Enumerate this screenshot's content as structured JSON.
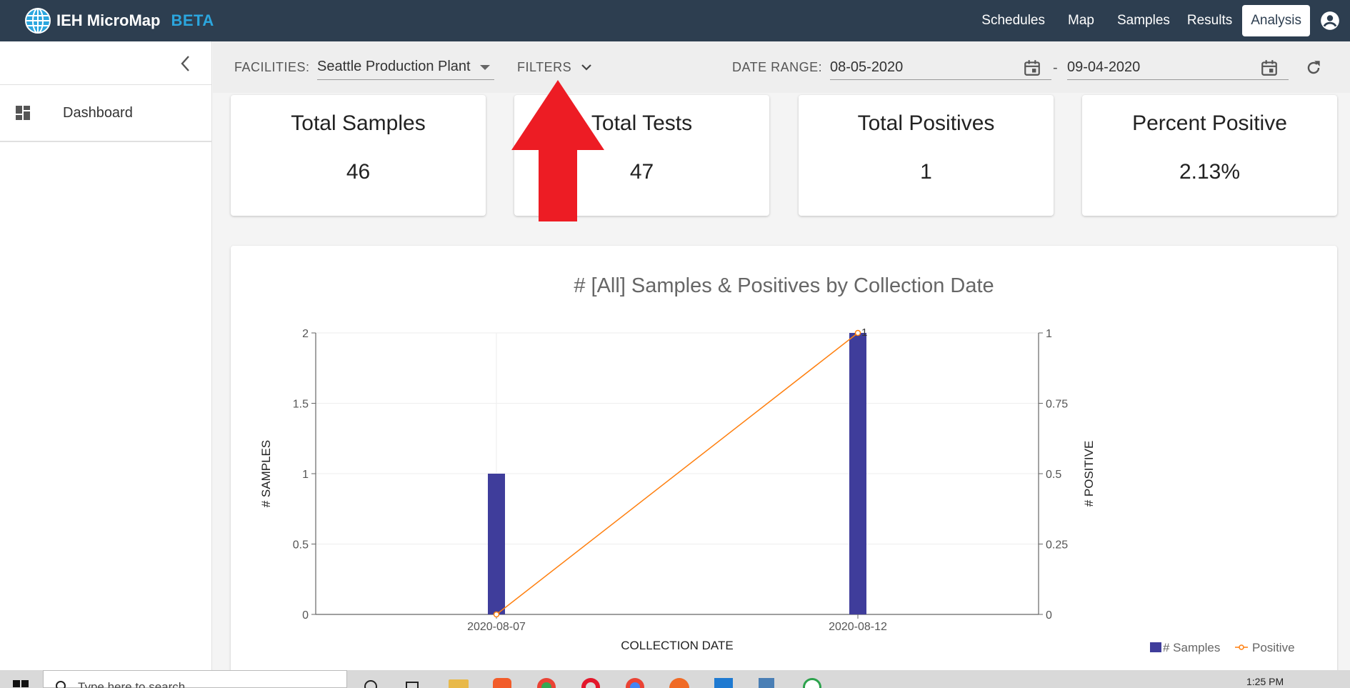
{
  "app": {
    "name": "IEH MicroMap",
    "badge": "BETA"
  },
  "nav": {
    "items": [
      {
        "label": "Schedules"
      },
      {
        "label": "Map"
      },
      {
        "label": "Samples"
      },
      {
        "label": "Results"
      },
      {
        "label": "Analysis"
      }
    ],
    "active": "Analysis"
  },
  "sidebar": {
    "items": [
      {
        "label": "Dashboard"
      }
    ]
  },
  "filters": {
    "facilities_label": "FACILITIES:",
    "facility_value": "Seattle Production Plant",
    "filters_label": "FILTERS",
    "date_range_label": "DATE RANGE:",
    "date_from": "08-05-2020",
    "date_sep": "-",
    "date_to": "09-04-2020"
  },
  "stats": [
    {
      "title": "Total Samples",
      "value": "46"
    },
    {
      "title": "Total Tests",
      "value": "47"
    },
    {
      "title": "Total Positives",
      "value": "1"
    },
    {
      "title": "Percent Positive",
      "value": "2.13%"
    }
  ],
  "chart_data": {
    "type": "bar",
    "title": "# [All] Samples & Positives by Collection Date",
    "xlabel": "COLLECTION DATE",
    "ylabel": "# SAMPLES",
    "y2label": "# POSITIVE",
    "categories": [
      "2020-08-07",
      "2020-08-12"
    ],
    "series": [
      {
        "name": "# Samples",
        "type": "bar",
        "axis": "left",
        "values": [
          1,
          2
        ],
        "color": "#3f3d9b"
      },
      {
        "name": "Positive",
        "type": "line",
        "axis": "right",
        "values": [
          0,
          1
        ],
        "color": "#ff7f0e"
      }
    ],
    "ylim": [
      0,
      2
    ],
    "y2lim": [
      0,
      1
    ],
    "yticks": [
      "0",
      "0.5",
      "1",
      "1.5",
      "2"
    ],
    "y2ticks": [
      "0",
      "0.25",
      "0.5",
      "0.75",
      "1"
    ],
    "data_labels": [
      "1"
    ],
    "grid": true,
    "legend": "bottom-right"
  },
  "taskbar": {
    "search_placeholder": "Type here to search",
    "time": "1:25 PM"
  },
  "colors": {
    "topbar": "#2d3e50",
    "accent": "#2ba6de",
    "arrow": "#ed1c24",
    "bar": "#3f3d9b",
    "line": "#ff7f0e"
  }
}
